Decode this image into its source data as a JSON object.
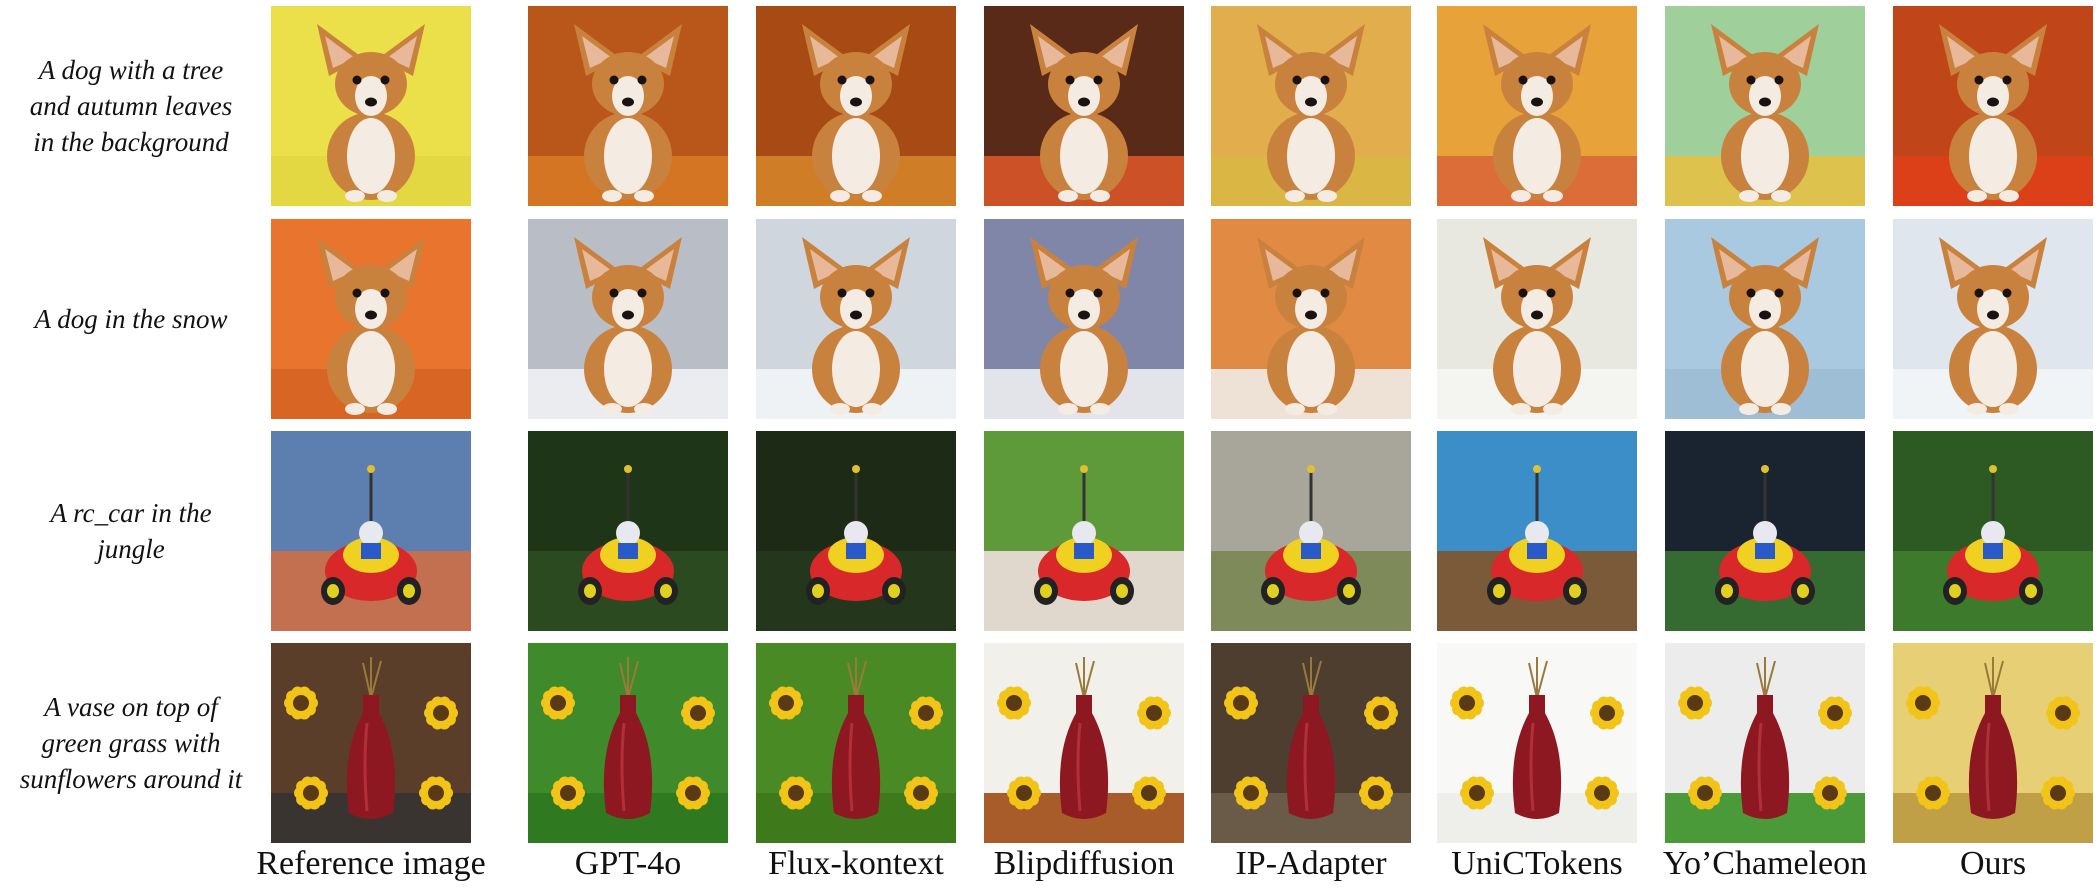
{
  "rows": [
    {
      "prompt": "A dog with a tree\nand autumn leaves\nin the background",
      "subject": "dog",
      "backgrounds": [
        "#ece04a",
        "#b9561a",
        "#a84a14",
        "#5a2a18",
        "#e2ad4c",
        "#e8a23a",
        "#9fcf9a",
        "#c0461a"
      ],
      "accents": [
        "#e2d640",
        "#d77a26",
        "#d7862a",
        "#e0582a",
        "#d8b844",
        "#d9643a",
        "#e8c040",
        "#e0401a"
      ]
    },
    {
      "prompt": "A dog in the snow",
      "subject": "dog",
      "backgrounds": [
        "#e8742e",
        "#b9bec6",
        "#cfd6dd",
        "#7f86a8",
        "#e08a44",
        "#e8e8e0",
        "#a9c9e0",
        "#dfe6ee"
      ],
      "accents": [
        "#d56322",
        "#f2f4f6",
        "#f5f7f9",
        "#f4f4f6",
        "#f0f0f0",
        "#f6f6f2",
        "#9cbcd4",
        "#f4f6f8"
      ]
    },
    {
      "prompt": "A rc_car in the\njungle",
      "subject": "car",
      "backgrounds": [
        "#5d7fb0",
        "#1f3518",
        "#1c2a16",
        "#5f9a3a",
        "#a8a69a",
        "#3c8ec8",
        "#1a2430",
        "#2d5a22"
      ],
      "accents": [
        "#c27050",
        "#2c4a20",
        "#24361c",
        "#e0d8cc",
        "#7e8a5a",
        "#7a5a38",
        "#356a30",
        "#3e7a2c"
      ]
    },
    {
      "prompt": "A vase on top of\ngreen grass with\nsunflowers around it",
      "subject": "vase",
      "backgrounds": [
        "#5a3e2a",
        "#3f8a2a",
        "#4a8a24",
        "#f2f0ea",
        "#4e3e30",
        "#f8f8f6",
        "#ececec",
        "#e6cf74"
      ],
      "accents": [
        "#3a3430",
        "#2f7a20",
        "#3e7a1c",
        "#a85c2a",
        "#6a5a48",
        "#eeeeea",
        "#4a9a3a",
        "#c0a046"
      ]
    }
  ],
  "columns": [
    "Reference image",
    "GPT-4o",
    "Flux-kontext",
    "Blipdiffusion",
    "IP-Adapter",
    "UniCTokens",
    "Yo’Chameleon",
    "Ours"
  ]
}
